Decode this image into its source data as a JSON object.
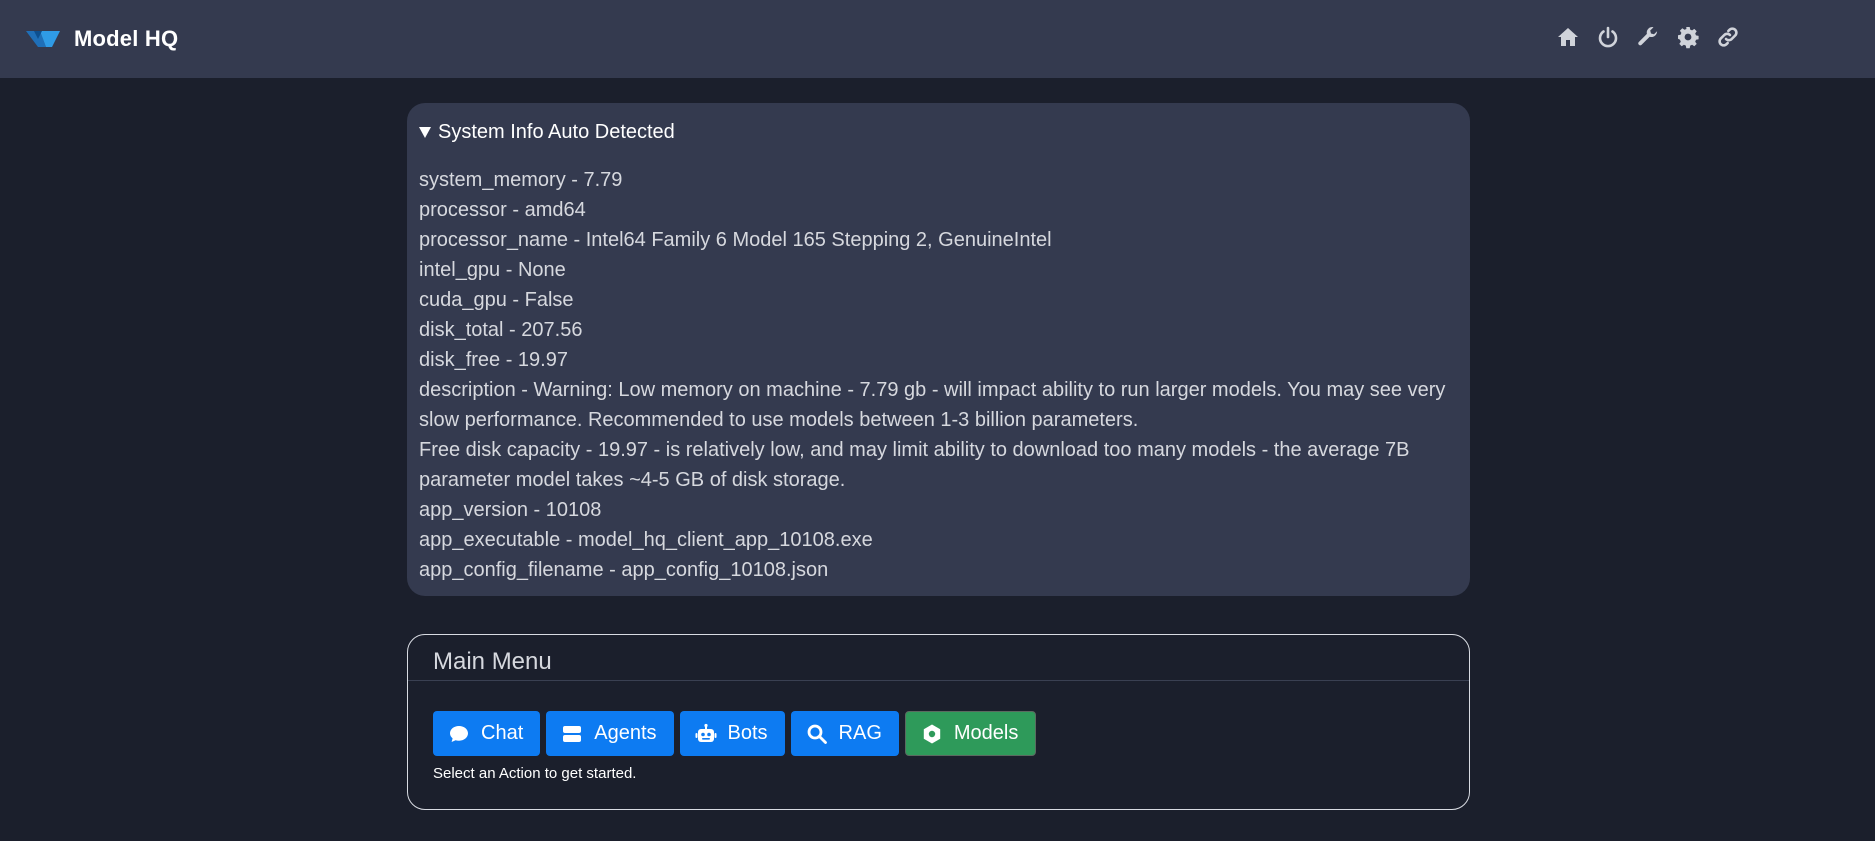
{
  "app": {
    "title": "Model HQ"
  },
  "nav": {
    "icons": [
      "home-icon",
      "power-icon",
      "wrench-icon",
      "gear-icon",
      "link-icon"
    ],
    "icon_color": "#d0d3da"
  },
  "system_info": {
    "summary": "System Info Auto Detected",
    "lines": [
      "system_memory - 7.79",
      "processor - amd64",
      "processor_name - Intel64 Family 6 Model 165 Stepping 2, GenuineIntel",
      "intel_gpu - None",
      "cuda_gpu - False",
      "disk_total - 207.56",
      "disk_free - 19.97"
    ],
    "description": "description - Warning: Low memory on machine - 7.79 gb - will impact ability to run larger models.  You may see very slow performance.  Recommended to use models between 1-3 billion parameters.",
    "disk_note": "Free disk capacity - 19.97 - is relatively low, and may limit ability to download too many models - the average 7B parameter model takes ~4-5 GB of disk storage.",
    "footer_lines": [
      "app_version - 10108",
      "app_executable - model_hq_client_app_10108.exe",
      "app_config_filename - app_config_10108.json"
    ]
  },
  "main_menu": {
    "title": "Main Menu",
    "buttons": [
      {
        "label": "Chat",
        "icon": "chat-bubble-icon",
        "color": "#0d7bf2"
      },
      {
        "label": "Agents",
        "icon": "server-icon",
        "color": "#0d7bf2"
      },
      {
        "label": "Bots",
        "icon": "robot-icon",
        "color": "#0d7bf2"
      },
      {
        "label": "RAG",
        "icon": "search-icon",
        "color": "#0d7bf2"
      },
      {
        "label": "Models",
        "icon": "cog-icon",
        "color": "#2e9a5a"
      }
    ],
    "hint": "Select an Action to get started."
  },
  "colors": {
    "background": "#1b1f2c",
    "panel": "#343a4f",
    "primary": "#0d7bf2",
    "success": "#2e9a5a"
  }
}
